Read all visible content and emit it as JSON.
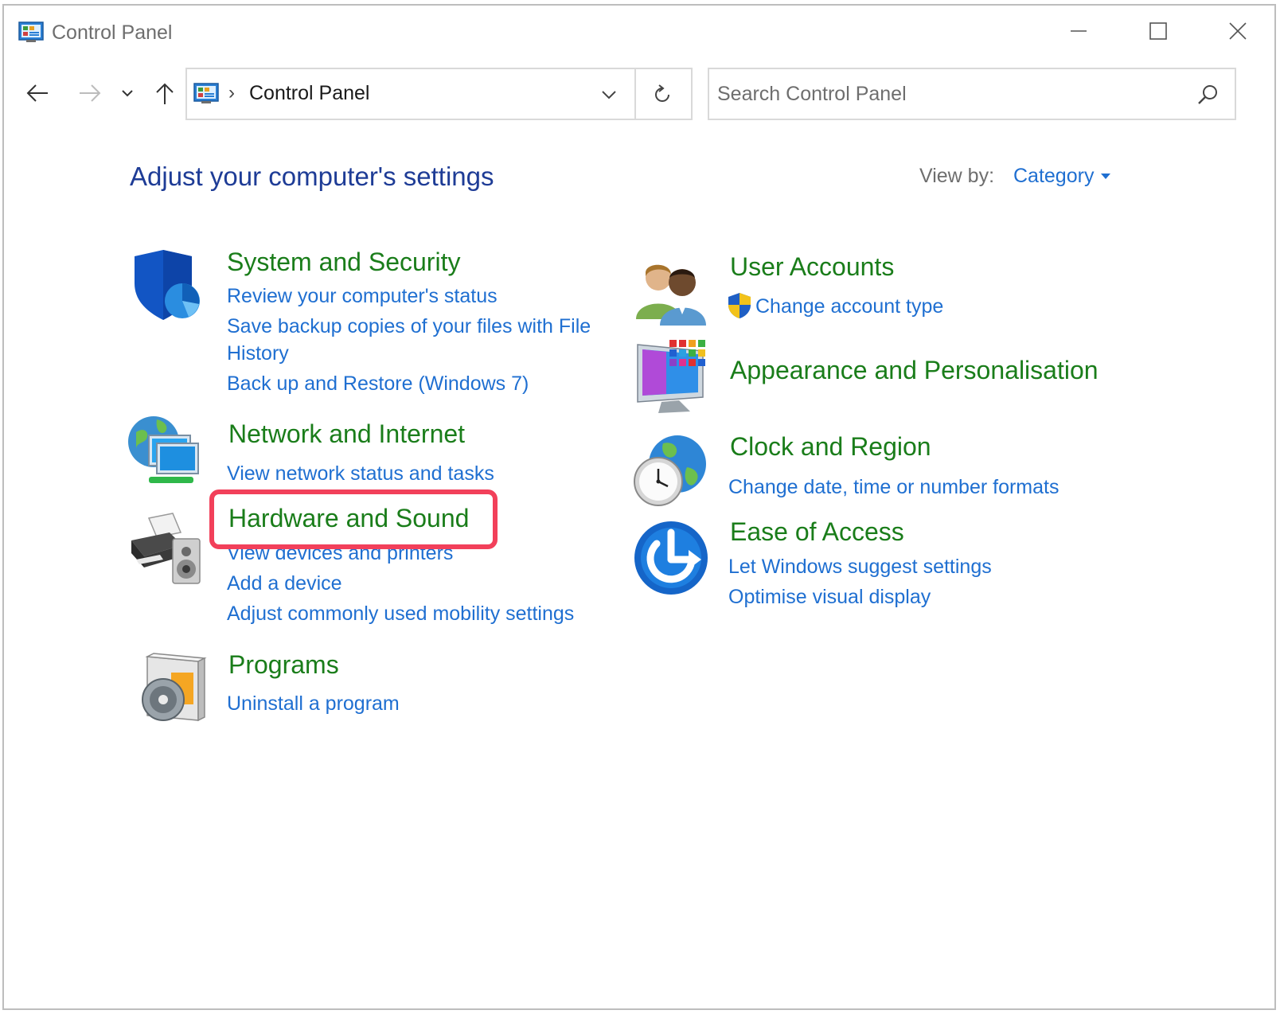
{
  "window": {
    "title": "Control Panel"
  },
  "address_bar": {
    "path": "Control Panel",
    "separator": "›"
  },
  "search": {
    "placeholder": "Search Control Panel"
  },
  "main": {
    "heading": "Adjust your computer's settings",
    "view_by_label": "View by:",
    "view_by_value": "Category"
  },
  "categories": {
    "system_security": {
      "title": "System and Security",
      "icon": "shield-icon",
      "links": [
        "Review your computer's status",
        "Save backup copies of your files with File",
        "History",
        "Back up and Restore (Windows 7)"
      ]
    },
    "network_internet": {
      "title": "Network and Internet",
      "icon": "network-globe-icon",
      "links": [
        "View network status and tasks"
      ]
    },
    "hardware_sound": {
      "title": "Hardware and Sound",
      "icon": "printer-speaker-icon",
      "links": [
        "View devices and printers",
        "Add a device",
        "Adjust commonly used mobility settings"
      ]
    },
    "programs": {
      "title": "Programs",
      "icon": "programs-disc-icon",
      "links": [
        "Uninstall a program"
      ]
    },
    "user_accounts": {
      "title": "User Accounts",
      "icon": "users-icon",
      "links": [
        "Change account type"
      ]
    },
    "appearance": {
      "title": "Appearance and Personalisation",
      "icon": "monitor-palette-icon",
      "links": []
    },
    "clock_region": {
      "title": "Clock and Region",
      "icon": "clock-globe-icon",
      "links": [
        "Change date, time or number formats"
      ]
    },
    "ease_access": {
      "title": "Ease of Access",
      "icon": "ease-of-access-icon",
      "links": [
        "Let Windows suggest settings",
        "Optimise visual display"
      ]
    }
  },
  "colors": {
    "category_title": "#1a7d1a",
    "link": "#1f6fd1",
    "heading": "#1e3c96",
    "highlight": "#f2405a"
  }
}
